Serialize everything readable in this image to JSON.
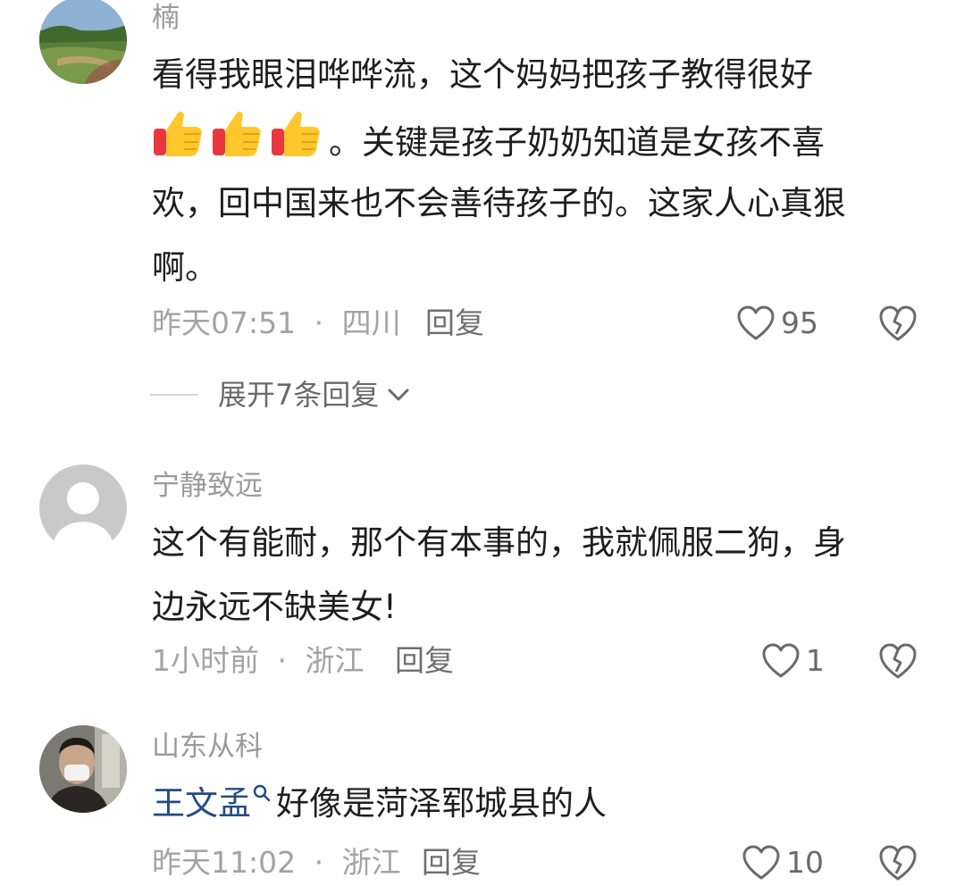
{
  "comments": [
    {
      "username": "楠",
      "lines": [
        "看得我眼泪哗哗流，这个妈妈把孩子教得很好",
        "。关键是孩子奶奶知道是女孩不喜",
        "欢，回中国来也不会善待孩子的。这家人心真狠",
        "啊。"
      ],
      "emoji": [
        "thumbs-up-emoji",
        "thumbs-up-emoji",
        "thumbs-up-emoji"
      ],
      "time": "昨天07:51",
      "separator": "·",
      "location": "四川",
      "reply_label": "回复",
      "likes": "95"
    },
    {
      "username": "宁静致远",
      "lines": [
        "这个有能耐，那个有本事的，我就佩服二狗，身",
        "边永远不缺美女!"
      ],
      "time": "1小时前",
      "separator": "·",
      "location": "浙江",
      "reply_label": "回复",
      "likes": "1"
    },
    {
      "username": "山东从科",
      "mention": "王文孟",
      "text_after_mention": "好像是菏泽郓城县的人",
      "time": "昨天11:02",
      "separator": "·",
      "location": "浙江",
      "reply_label": "回复",
      "likes": "10"
    }
  ],
  "expand_replies": {
    "label": "展开7条回复"
  },
  "icons": {
    "like": "heart-outline-icon",
    "dislike": "broken-heart-icon",
    "expand": "chevron-down-icon",
    "search_mark": "search-icon"
  },
  "colors": {
    "username": "#9a9a9a",
    "meta": "#a3a3a3",
    "mention": "#254a86",
    "icon": "#6a6a6a"
  }
}
